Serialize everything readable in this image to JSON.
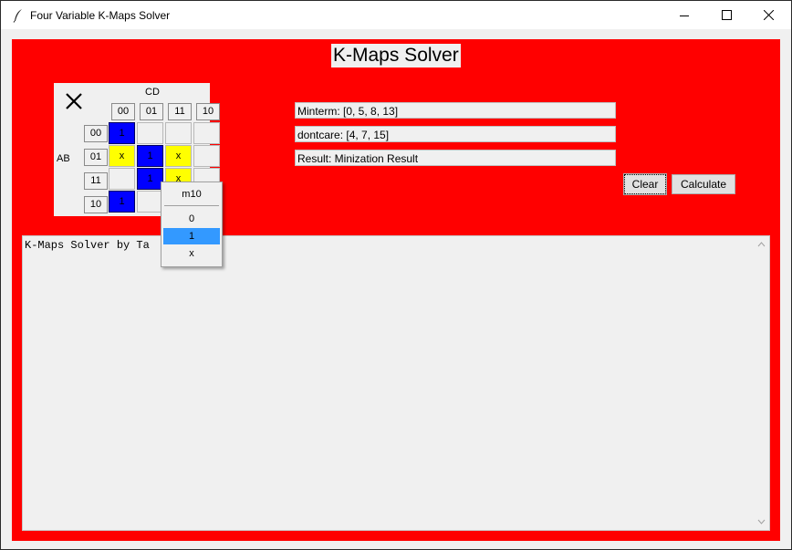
{
  "window": {
    "title": "Four Variable K-Maps Solver"
  },
  "header": {
    "title": "K-Maps Solver"
  },
  "kmap": {
    "cd_label": "CD",
    "ab_label": "AB",
    "columns": [
      "00",
      "01",
      "11",
      "10"
    ],
    "rows": [
      "00",
      "01",
      "11",
      "10"
    ],
    "cells": [
      [
        "1",
        "",
        "",
        ""
      ],
      [
        "x",
        "1",
        "x",
        ""
      ],
      [
        "",
        "1",
        "x",
        ""
      ],
      [
        "1",
        "",
        "",
        ""
      ]
    ]
  },
  "fields": {
    "minterm": "Minterm: [0, 5, 8, 13]",
    "dontcare": "dontcare: [4, 7, 15]",
    "result": "Result: Minization Result"
  },
  "buttons": {
    "clear": "Clear",
    "calculate": "Calculate"
  },
  "popup": {
    "title": "m10",
    "options": [
      "0",
      "1",
      "x"
    ],
    "selected": "1"
  },
  "output": {
    "text": "K-Maps Solver by Ta      L"
  },
  "colors": {
    "app_bg": "#ff0000",
    "one_cell": "#0000ff",
    "dontcare_cell": "#ffff00",
    "selected_option": "#3399ff"
  }
}
